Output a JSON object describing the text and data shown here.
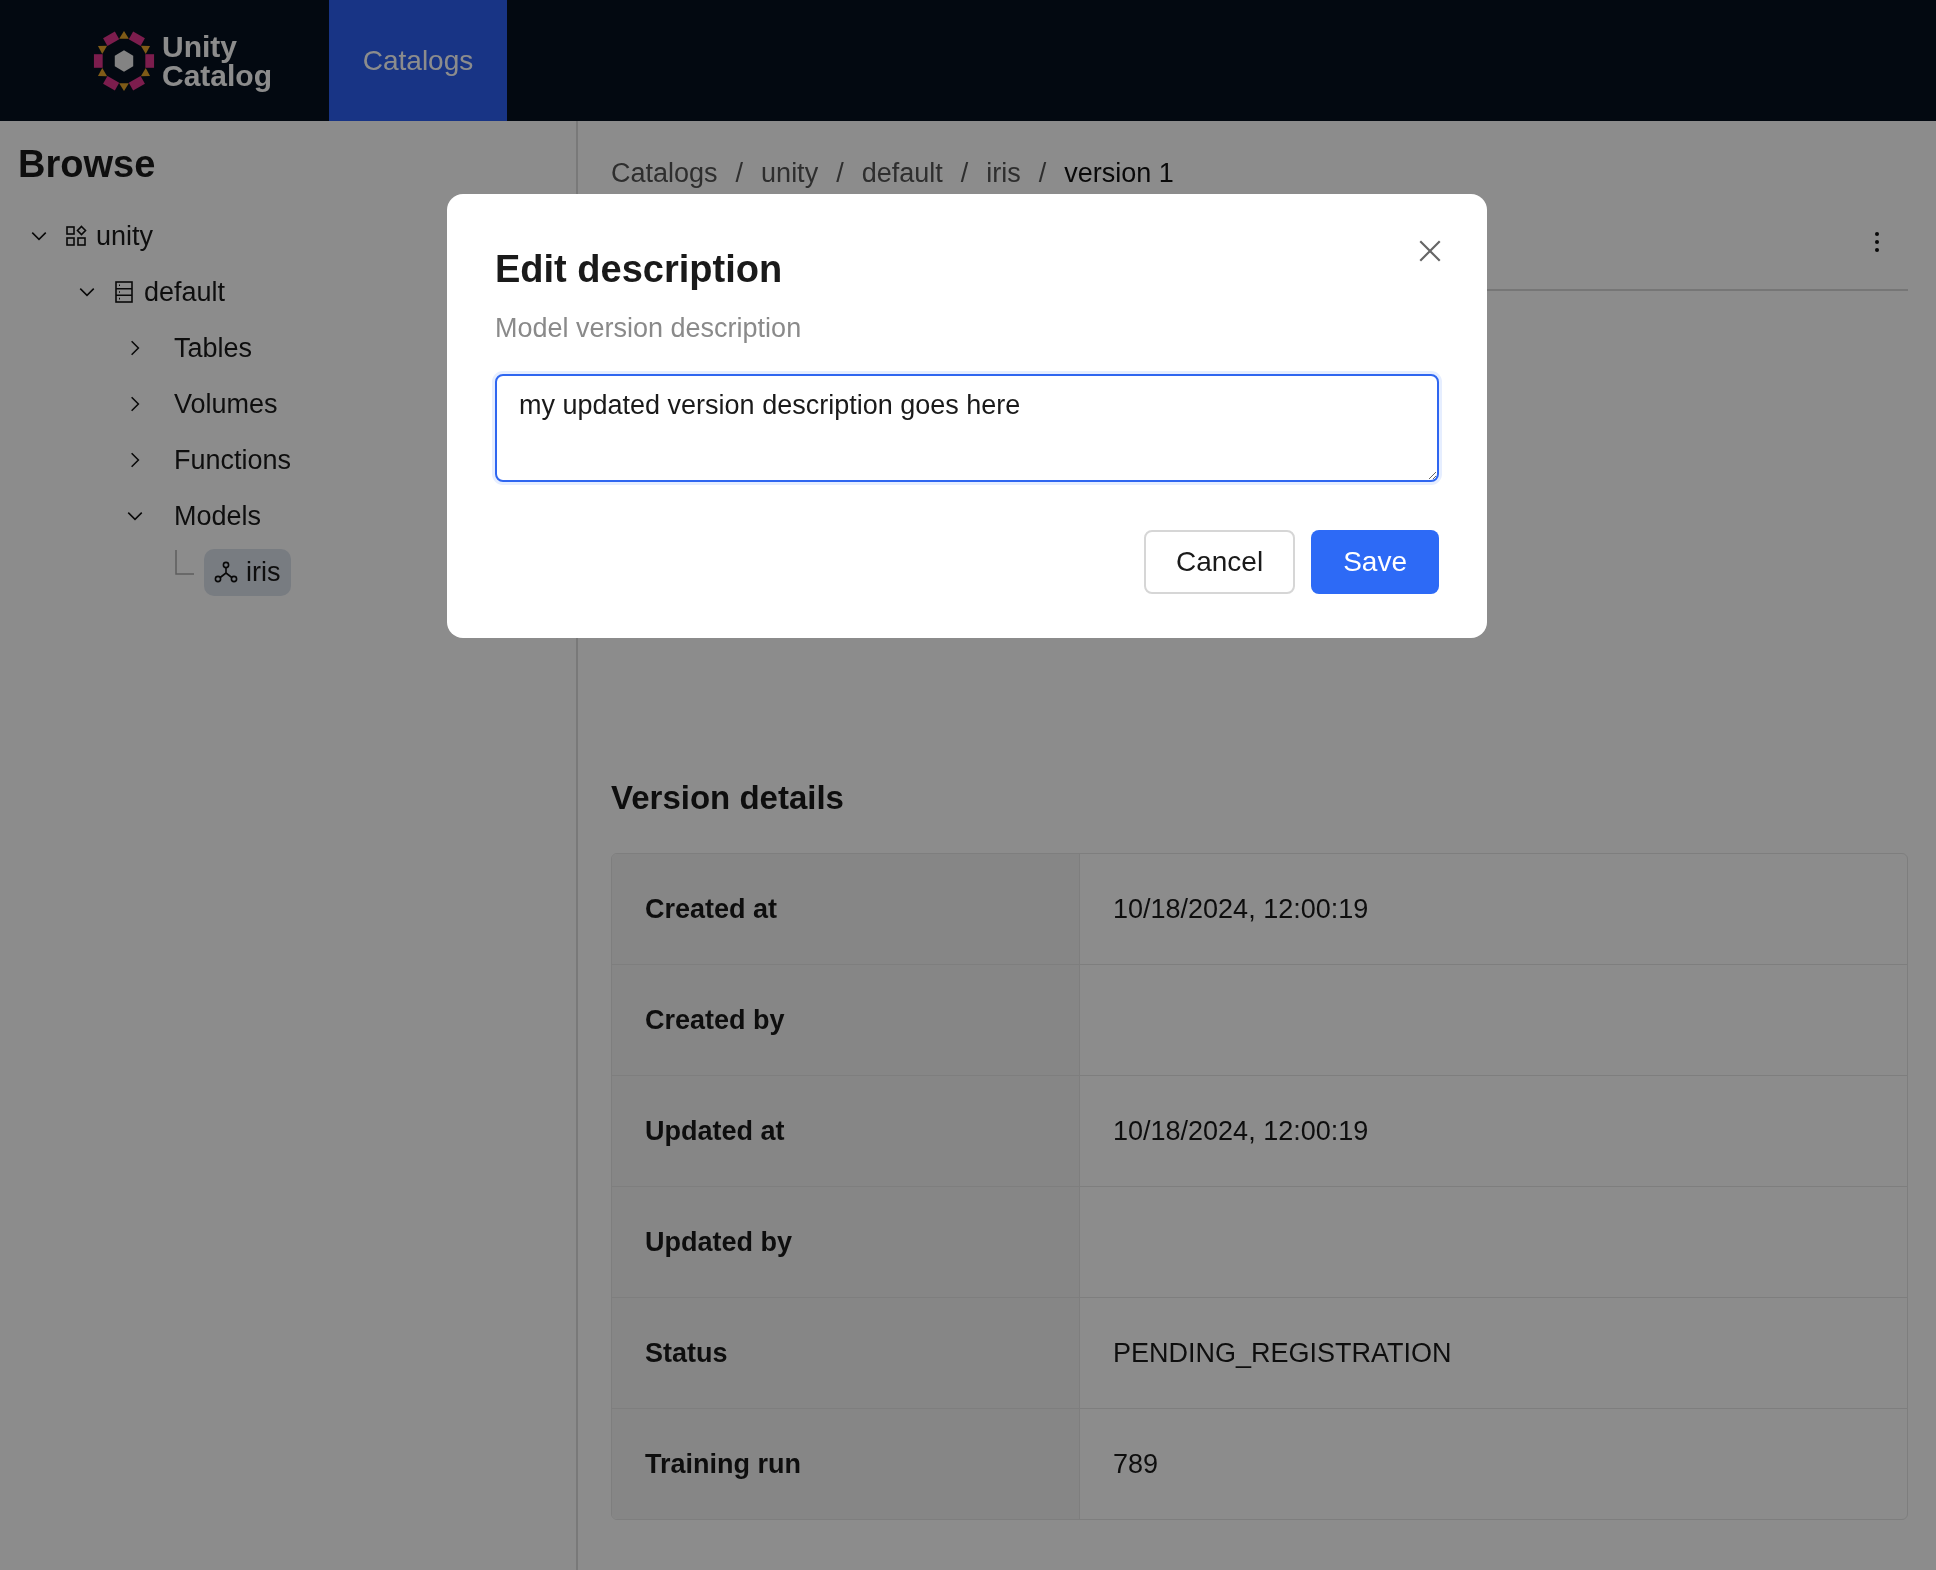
{
  "header": {
    "logo": {
      "lines": [
        "Unity",
        "Catalog"
      ]
    },
    "nav_tabs": [
      {
        "label": "Catalogs",
        "selected": true
      }
    ]
  },
  "sidebar": {
    "title": "Browse",
    "tree": [
      {
        "label": "unity",
        "kind": "catalog",
        "expanded": true,
        "selected": false,
        "children": [
          {
            "label": "default",
            "kind": "schema",
            "expanded": true,
            "selected": false,
            "children": [
              {
                "label": "Tables",
                "kind": "group",
                "expanded": false,
                "selected": false
              },
              {
                "label": "Volumes",
                "kind": "group",
                "expanded": false,
                "selected": false
              },
              {
                "label": "Functions",
                "kind": "group",
                "expanded": false,
                "selected": false
              },
              {
                "label": "Models",
                "kind": "group",
                "expanded": true,
                "selected": false,
                "children": [
                  {
                    "label": "iris",
                    "kind": "model",
                    "selected": true
                  }
                ]
              }
            ]
          }
        ]
      }
    ]
  },
  "main": {
    "breadcrumb": [
      {
        "kind": "link",
        "text": "Catalogs"
      },
      {
        "kind": "separator",
        "text": "/"
      },
      {
        "kind": "link",
        "text": "unity"
      },
      {
        "kind": "separator",
        "text": "/"
      },
      {
        "kind": "link",
        "text": "default"
      },
      {
        "kind": "separator",
        "text": "/"
      },
      {
        "kind": "link",
        "text": "iris"
      },
      {
        "kind": "separator",
        "text": "/"
      },
      {
        "kind": "current",
        "text": "version 1"
      }
    ],
    "version_details": {
      "title": "Version details",
      "rows": [
        {
          "label": "Created at",
          "value": "10/18/2024, 12:00:19"
        },
        {
          "label": "Created by"
        },
        {
          "label": "Updated at",
          "value": "10/18/2024, 12:00:19"
        },
        {
          "label": "Updated by"
        },
        {
          "label": "Status",
          "value": "PENDING_REGISTRATION"
        },
        {
          "label": "Training run",
          "value": "789"
        }
      ]
    }
  },
  "modal": {
    "title": "Edit description",
    "label": "Model version description",
    "value": "my updated version description goes here",
    "buttons": [
      {
        "label": "Cancel",
        "kind": "secondary"
      },
      {
        "label": "Save",
        "kind": "primary"
      }
    ]
  }
}
